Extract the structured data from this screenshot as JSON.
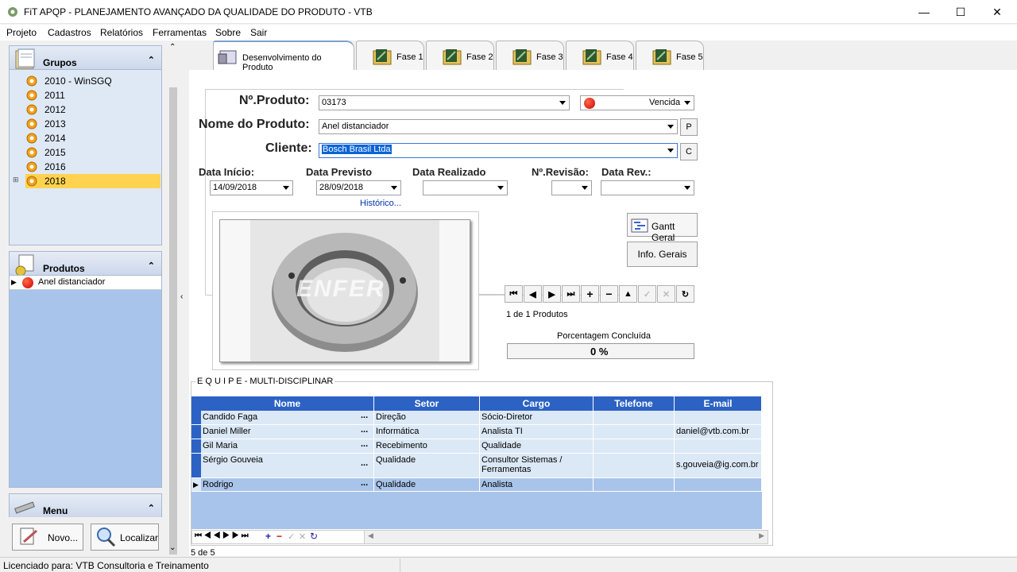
{
  "window": {
    "title": "FiT APQP - PLANEJAMENTO AVANÇADO DA QUALIDADE DO PRODUTO - VTB",
    "minimize": "—",
    "maximize": "☐",
    "close": "✕"
  },
  "menu": [
    "Projeto",
    "Cadastros",
    "Relatórios",
    "Ferramentas",
    "Sobre",
    "Sair"
  ],
  "left": {
    "groups_title": "Grupos",
    "groups": [
      "2010 - WinSGQ",
      "2011",
      "2012",
      "2013",
      "2014",
      "2015",
      "2016",
      "2018"
    ],
    "selected_group": "2018",
    "products_title": "Produtos",
    "products": [
      "Anel distanciador"
    ],
    "menu_title": "Menu",
    "novo_label": "Novo...",
    "localizar_label": "Localizar..."
  },
  "tabs": [
    "Desenvolvimento do Produto",
    "Fase 1",
    "Fase 2",
    "Fase 3",
    "Fase 4",
    "Fase 5"
  ],
  "form": {
    "produto_label": "Nº.Produto:",
    "produto_value": "03173",
    "status_value": "Vencida",
    "nome_label": "Nome do Produto:",
    "nome_value": "Anel distanciador",
    "p_button": "P",
    "cliente_label": "Cliente:",
    "cliente_value": "Bosch Brasil Ltda",
    "c_button": "C",
    "data_inicio_label": "Data Início:",
    "data_inicio_value": "14/09/2018",
    "data_previsto_label": "Data Previsto",
    "data_previsto_value": "28/09/2018",
    "data_realizado_label": "Data Realizado",
    "revisao_label": "Nº.Revisão:",
    "data_rev_label": "Data Rev.:",
    "historico_link": "Histórico...",
    "gantt_button": "Gantt Geral",
    "info_button": "Info. Gerais",
    "image_logo": "ENFER",
    "record_count": "1 de  1  Produtos",
    "percent_label": "Porcentagem Concluída",
    "percent_value": "0 %",
    "percent_fraction": 0
  },
  "team": {
    "title": "E Q U I P E  - MULTI-DISCIPLINAR",
    "columns": [
      "Nome",
      "Setor",
      "Cargo",
      "Telefone",
      "E-mail"
    ],
    "rows": [
      {
        "nome": "Candido Faga",
        "setor": "Direção",
        "cargo": "Sócio-Diretor",
        "telefone": "",
        "email": ""
      },
      {
        "nome": "Daniel Miller",
        "setor": "Informática",
        "cargo": "Analista TI",
        "telefone": "",
        "email": "daniel@vtb.com.br"
      },
      {
        "nome": "Gil Maria",
        "setor": "Recebimento",
        "cargo": "Qualidade",
        "telefone": "",
        "email": ""
      },
      {
        "nome": "Sérgio Gouveia",
        "setor": "Qualidade",
        "cargo": "Consultor Sistemas / Ferramentas",
        "telefone": "",
        "email": "s.gouveia@ig.com.br"
      },
      {
        "nome": "Rodrigo",
        "setor": "Qualidade",
        "cargo": "Analista",
        "telefone": "",
        "email": ""
      }
    ],
    "ellipsis": "...",
    "count": "5 de 5"
  },
  "status": {
    "license": "Licenciado para: VTB Consultoria e Treinamento"
  },
  "colors": {
    "grid_header": "#2b62c4",
    "selected_group": "#ffd34f",
    "panel_bg": "#dfe9f5"
  }
}
